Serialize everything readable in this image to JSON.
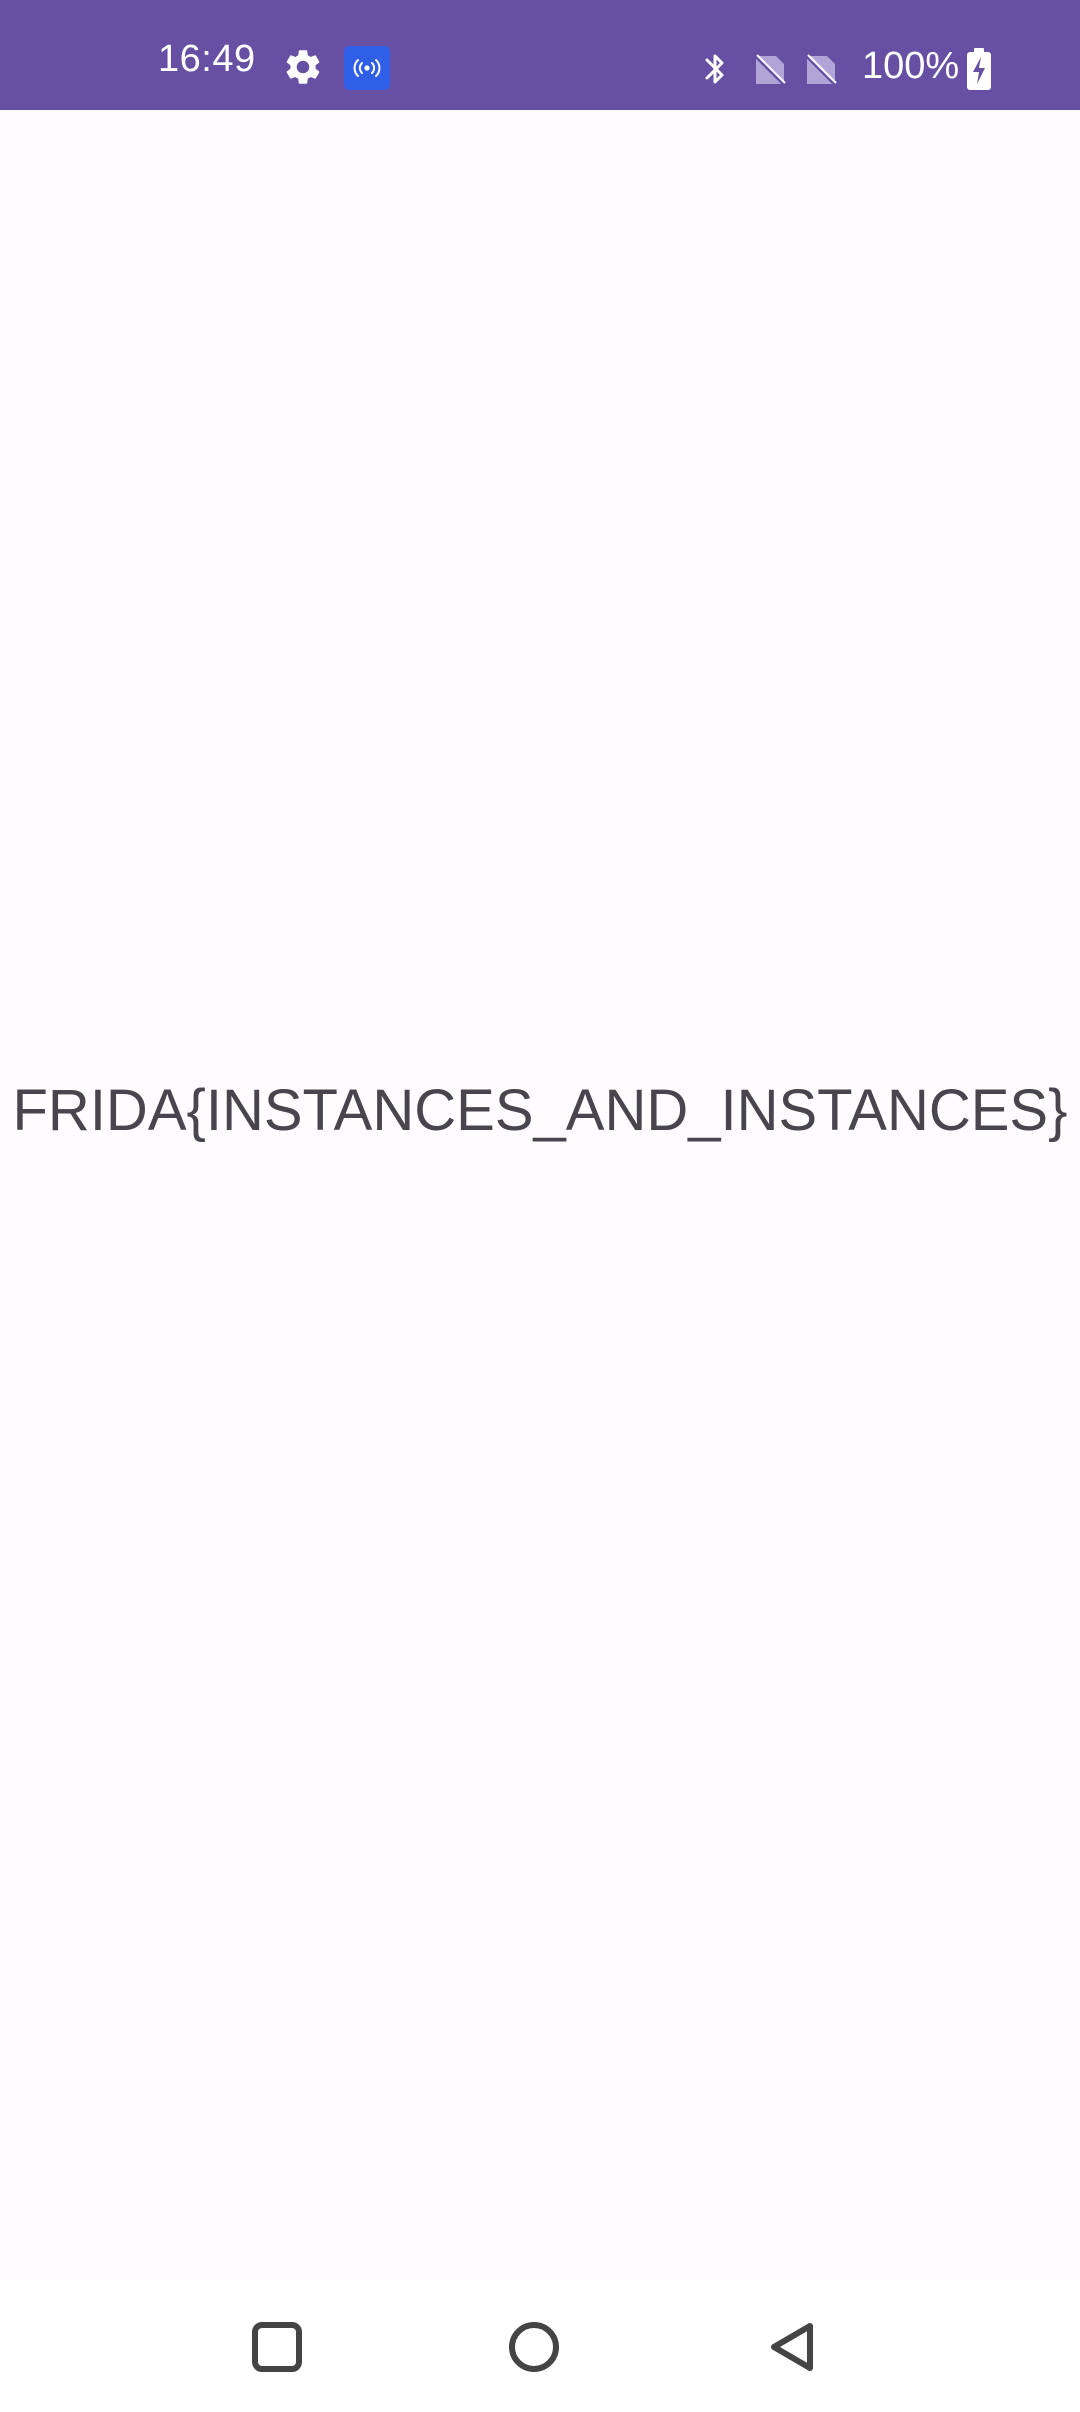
{
  "status_bar": {
    "time": "16:49",
    "battery_percent": "100%",
    "background_color": "#6750a4",
    "icons": [
      "gear-icon",
      "hotspot-icon",
      "bluetooth-icon",
      "no-sim-icon",
      "no-sim-icon",
      "battery-charging-icon"
    ]
  },
  "main": {
    "flag_text": "FRIDA{INSTANCES_AND_INSTANCES}",
    "text_color": "#49454f",
    "background_color": "#fffbfe"
  },
  "nav_bar": {
    "buttons": [
      "recents-icon",
      "home-icon",
      "back-icon"
    ]
  }
}
